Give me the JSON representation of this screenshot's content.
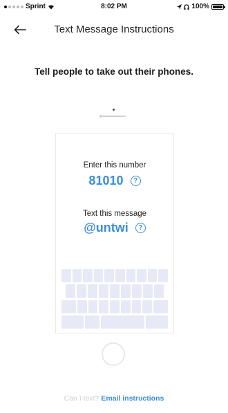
{
  "status_bar": {
    "carrier": "Sprint",
    "time": "8:02 PM",
    "battery": "100%"
  },
  "header": {
    "title": "Text Message Instructions"
  },
  "main": {
    "instruction": "Tell people to take out their phones."
  },
  "phone": {
    "number_label": "Enter this number",
    "number_value": "81010",
    "message_label": "Text this message",
    "message_value": "@untwi",
    "help_symbol": "?"
  },
  "footer": {
    "muted_text": "Can I text?",
    "link_text": "Email instructions"
  },
  "colors": {
    "accent": "#3b8fd9",
    "text": "#1d1d1f",
    "keyboard": "#e8e9f6"
  }
}
